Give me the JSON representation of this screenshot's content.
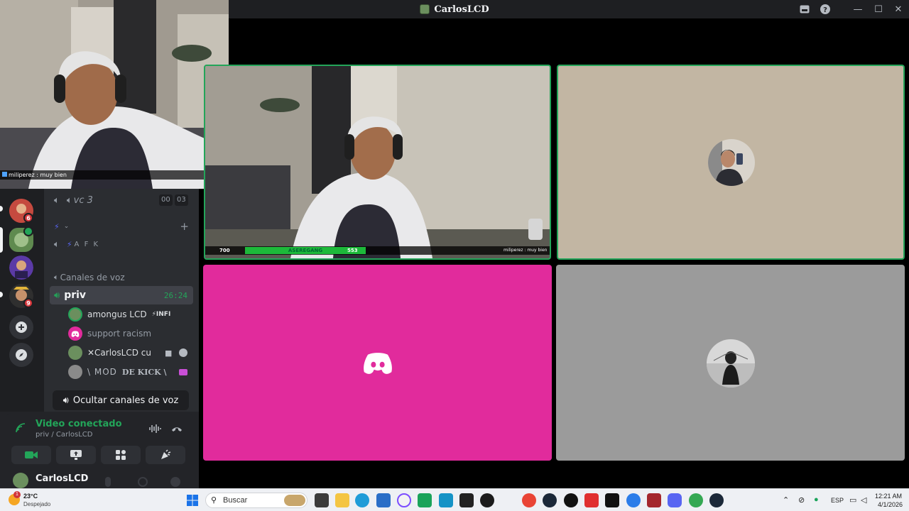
{
  "window": {
    "title": "CarlosLCD",
    "inbox_icon": "inbox-icon",
    "help_icon": "help-icon",
    "minimize": "—",
    "maximize": "☐",
    "close": "✕"
  },
  "pip_overlay": {
    "chat_user": "miliperez",
    "chat_sep": " : ",
    "chat_text": "muy bien"
  },
  "servers": [
    {
      "badge": "6"
    },
    {
      "badge": ""
    },
    {
      "badge": ""
    },
    {
      "badge": "9"
    }
  ],
  "channels": {
    "vc3_label": "vc 3",
    "vc3_counts": [
      "00",
      "03"
    ],
    "afk_label": "A F K",
    "category": "Canales de voz",
    "priv_label": "priv",
    "priv_timer": "26:24",
    "hide_button": "Ocultar canales de voz"
  },
  "members": [
    {
      "name": "amongus LCD",
      "tag": "⚡INFI",
      "color": "#dbdee1"
    },
    {
      "name": "support racism",
      "tag": "",
      "color": "#949ba4"
    },
    {
      "name": "✕CarlosLCD cu",
      "tag": "",
      "color": "#dbdee1"
    },
    {
      "name": "\\ MOD",
      "tag": "DE KICK \\",
      "color": "#949ba4"
    }
  ],
  "voice": {
    "status": "Video conectado",
    "location": "priv / CarlosLCD"
  },
  "user": {
    "name": "CarlosLCD"
  },
  "video_overlay": {
    "left_num": "700",
    "name": "ASEREGANG",
    "right_num": "553",
    "chat_line": "miliperez : muy bien"
  },
  "taskbar": {
    "weather_temp": "23°C",
    "weather_desc": "Despejado",
    "search_placeholder": "Buscar",
    "lang": "ESP",
    "time": "12:21 AM",
    "date": "4/1/2026",
    "weather_alert": "1"
  },
  "colors": {
    "discord_blurple": "#5865f2",
    "speaking_green": "#23a559",
    "tile_pink": "#e12b9c",
    "tile_tan": "#c2b6a3",
    "tile_gray": "#9b9b9b"
  }
}
